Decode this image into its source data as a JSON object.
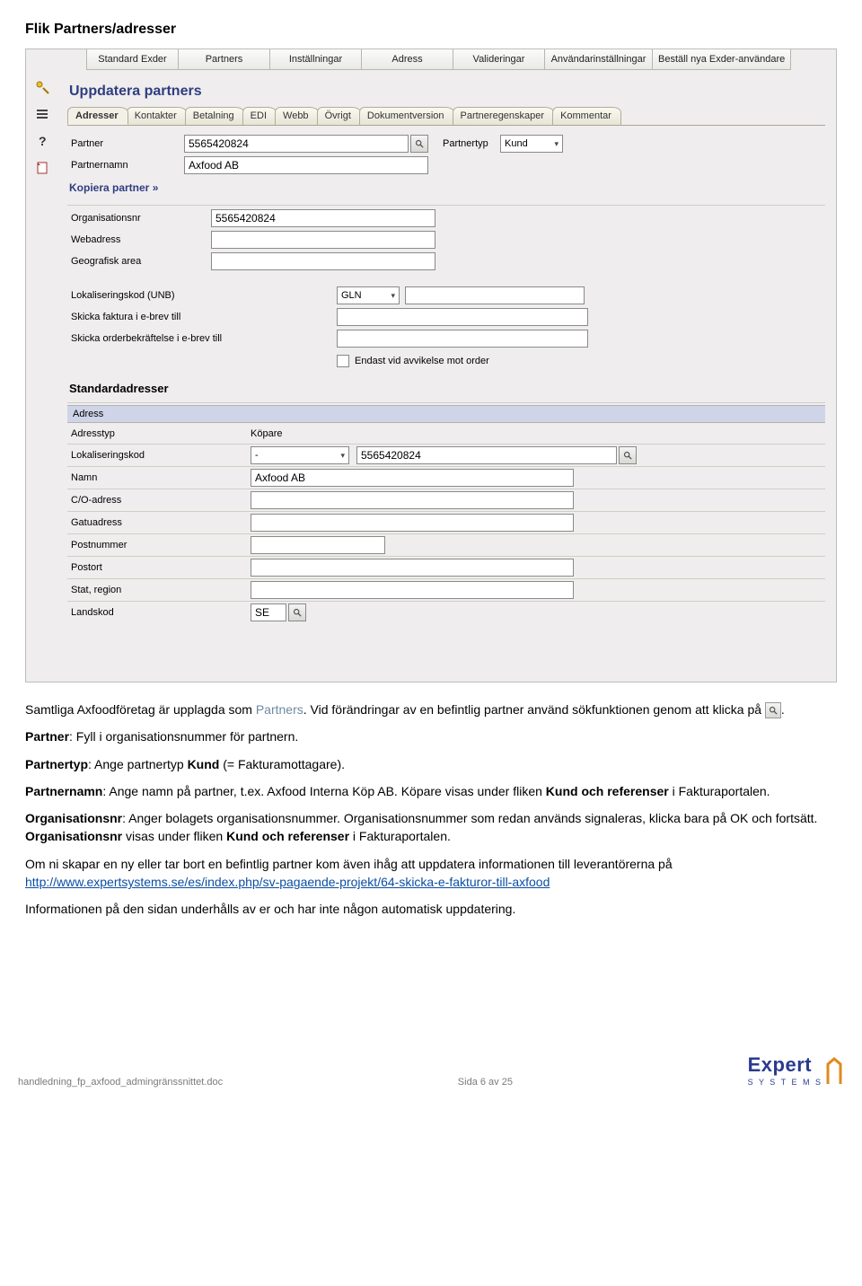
{
  "doc": {
    "heading": "Flik Partners/adresser"
  },
  "topmenu": {
    "items": [
      "Standard Exder",
      "Partners",
      "Inställningar",
      "Adress",
      "Valideringar",
      "Användarinställningar",
      "Beställ nya Exder-användare"
    ]
  },
  "panel": {
    "title": "Uppdatera partners"
  },
  "tabs": {
    "items": [
      "Adresser",
      "Kontakter",
      "Betalning",
      "EDI",
      "Webb",
      "Övrigt",
      "Dokumentversion",
      "Partneregenskaper",
      "Kommentar"
    ]
  },
  "partner": {
    "lbl_partner": "Partner",
    "partner_value": "5565420824",
    "lbl_type": "Partnertyp",
    "type_value": "Kund",
    "lbl_name": "Partnernamn",
    "name_value": "Axfood AB",
    "copy_link": "Kopiera partner »"
  },
  "org": {
    "lbl_orgnr": "Organisationsnr",
    "orgnr_value": "5565420824",
    "lbl_web": "Webadress",
    "web_value": "",
    "lbl_geo": "Geografisk area",
    "geo_value": "",
    "lbl_unb": "Lokaliseringskod (UNB)",
    "unb_select": "GLN",
    "unb_value": "",
    "lbl_einv": "Skicka faktura i e-brev till",
    "einv_value": "",
    "lbl_eorder": "Skicka orderbekräftelse i e-brev till",
    "eorder_value": "",
    "chk_label": "Endast vid avvikelse mot order"
  },
  "std": {
    "heading": "Standardadresser",
    "grid_head": "Adress",
    "rows": {
      "adresstyp": {
        "lbl": "Adresstyp",
        "val": "Köpare"
      },
      "lok": {
        "lbl": "Lokaliseringskod",
        "sel": "-",
        "val": "5565420824"
      },
      "namn": {
        "lbl": "Namn",
        "val": "Axfood AB"
      },
      "co": {
        "lbl": "C/O-adress",
        "val": ""
      },
      "gata": {
        "lbl": "Gatuadress",
        "val": ""
      },
      "postnr": {
        "lbl": "Postnummer",
        "val": ""
      },
      "postort": {
        "lbl": "Postort",
        "val": ""
      },
      "stat": {
        "lbl": "Stat, region",
        "val": ""
      },
      "landskod": {
        "lbl": "Landskod",
        "val": "SE"
      }
    }
  },
  "body": {
    "p1a": "Samtliga Axfoodföretag är upplagda som ",
    "p1_term": "Partners",
    "p1b": ". Vid förändringar av en befintlig partner använd sökfunktionen genom att klicka på ",
    "p1c": ".",
    "p2": "Partner: Fyll i organisationsnummer för partnern.",
    "p3": "Partnertyp: Ange partnertyp Kund (= Fakturamottagare).",
    "p4a": "Partnernamn",
    "p4b": ": Ange namn på partner, t.ex. Axfood Interna Köp AB. Köpare visas under fliken ",
    "p4c": "Kund och referenser",
    "p4d": " i Fakturaportalen.",
    "p5a": "Organisationsnr",
    "p5b": ": Anger bolagets organisationsnummer. Organisationsnummer som redan används signaleras, klicka bara på OK och fortsätt. ",
    "p5c": "Organisationsnr",
    "p5d": " visas under fliken ",
    "p5e": "Kund och referenser",
    "p5f": " i Fakturaportalen.",
    "p6a": "Om ni skapar en ny eller tar bort en befintlig partner kom även ihåg att uppdatera informationen till leverantörerna på ",
    "p6_link": "http://www.expertsystems.se/es/index.php/sv-pagaende-projekt/64-skicka-e-fakturor-till-axfood",
    "p7": "Informationen på den sidan underhålls av er och har inte någon automatisk uppdatering."
  },
  "footer": {
    "file": "handledning_fp_axfood_admingränssnittet.doc",
    "page": "Sida 6 av 25",
    "logo_main": "Expert",
    "logo_sub": "S Y S T E M S"
  }
}
